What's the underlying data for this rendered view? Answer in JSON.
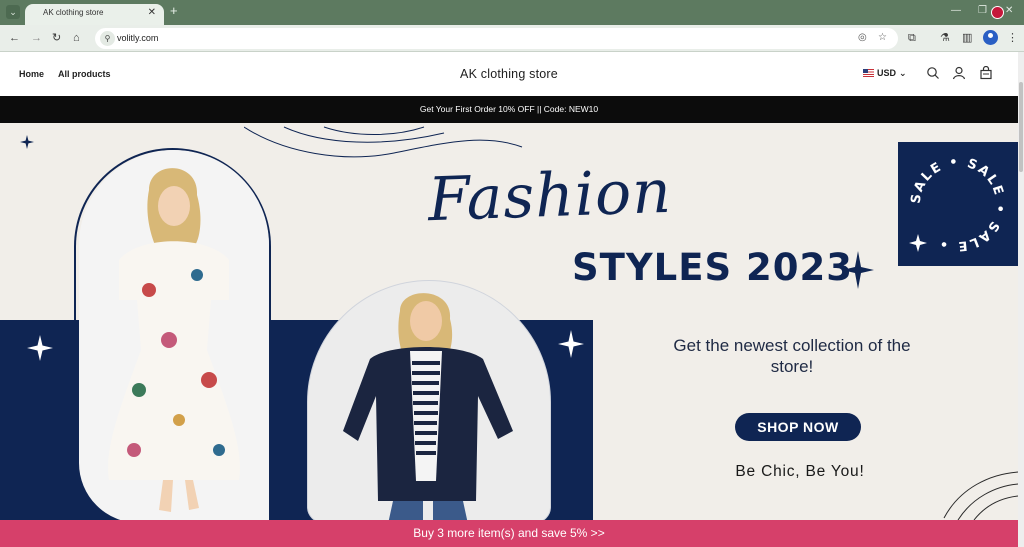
{
  "browser": {
    "tab_title": "AK clothing store",
    "tab_close": "✕",
    "new_tab": "+",
    "url": "volitly.com",
    "window_controls": [
      "—",
      "❐",
      "✕"
    ]
  },
  "store": {
    "nav": [
      "Home",
      "All products"
    ],
    "title": "AK clothing store",
    "currency": "USD",
    "currency_chevron": "⌄"
  },
  "announcement": "Get Your First Order 10% OFF || Code: NEW10",
  "hero": {
    "script_title": "Fashion",
    "styles_title": "STYLES 2023",
    "tagline": "Get the newest collection of the store!",
    "button": "SHOP NOW",
    "slogan": "Be Chic, Be You!",
    "sale_badge": "SALE • SALE • SALE •"
  },
  "promo_bar": "Buy 3 more item(s) and save 5%  >>",
  "icons": {
    "tab_menu": "chevron-down-icon",
    "back": "back-arrow-icon",
    "forward": "forward-arrow-icon",
    "reload": "reload-icon",
    "home": "home-icon",
    "site_info": "site-info-icon",
    "eye_off": "eye-off-icon",
    "bookmark": "star-icon",
    "extensions": "puzzle-icon",
    "labs": "flask-icon",
    "sidebar": "sidebar-icon",
    "profile": "profile-icon",
    "menu": "kebab-menu-icon",
    "search": "search-icon",
    "account": "account-icon",
    "cart": "bag-icon"
  },
  "colors": {
    "brand_navy": "#0f2553",
    "hero_bg": "#f1eee9",
    "promo_pink": "#d6406a",
    "chrome_green": "#5d7a60"
  }
}
